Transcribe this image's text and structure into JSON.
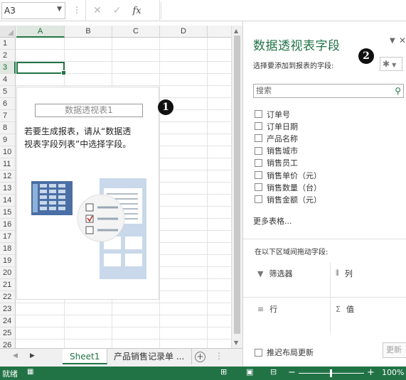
{
  "formula_bar": {
    "name_box": "A3",
    "formula": "",
    "fx_label": "fx"
  },
  "grid": {
    "columns": [
      "A",
      "B",
      "C",
      "D"
    ],
    "rows": [
      "1",
      "2",
      "3",
      "4",
      "5",
      "6",
      "7",
      "8",
      "9",
      "10",
      "11",
      "12",
      "13",
      "14",
      "15",
      "16",
      "17",
      "18",
      "19",
      "20",
      "21",
      "22",
      "23",
      "24",
      "25",
      "26"
    ],
    "selected_cell": "A3"
  },
  "pivot_placeholder": {
    "title": "数据透视表1",
    "instruction_line1": "若要生成报表，请从“数据透",
    "instruction_line2": "视表字段列表”中选择字段。"
  },
  "callouts": {
    "one": "1",
    "two": "2"
  },
  "sheet_tabs": {
    "tabs": [
      "Sheet1",
      "产品销售记录单 ..."
    ],
    "active": "Sheet1",
    "add_label": "+",
    "more_label": "⋮"
  },
  "field_pane": {
    "title": "数据透视表字段",
    "subtitle": "选择要添加到报表的字段:",
    "search_placeholder": "搜索",
    "fields": [
      "订单号",
      "订单日期",
      "产品名称",
      "销售城市",
      "销售员工",
      "销售单价（元）",
      "销售数量（台）",
      "销售金额（元）"
    ],
    "more_tables": "更多表格...",
    "areas_label": "在以下区域间拖动字段:",
    "areas": {
      "filters": "筛选器",
      "columns": "列",
      "rows": "行",
      "values": "值"
    },
    "defer_update": "推迟布局更新",
    "update_button": "更新"
  },
  "status_bar": {
    "ready": "就绪",
    "zoom": "100%",
    "zoom_level": 1.0
  },
  "colors": {
    "accent": "#217346",
    "grid_line": "#e3e3e3",
    "illustration_blue": "#4a6fa5",
    "illustration_light": "#c9d8ea"
  }
}
